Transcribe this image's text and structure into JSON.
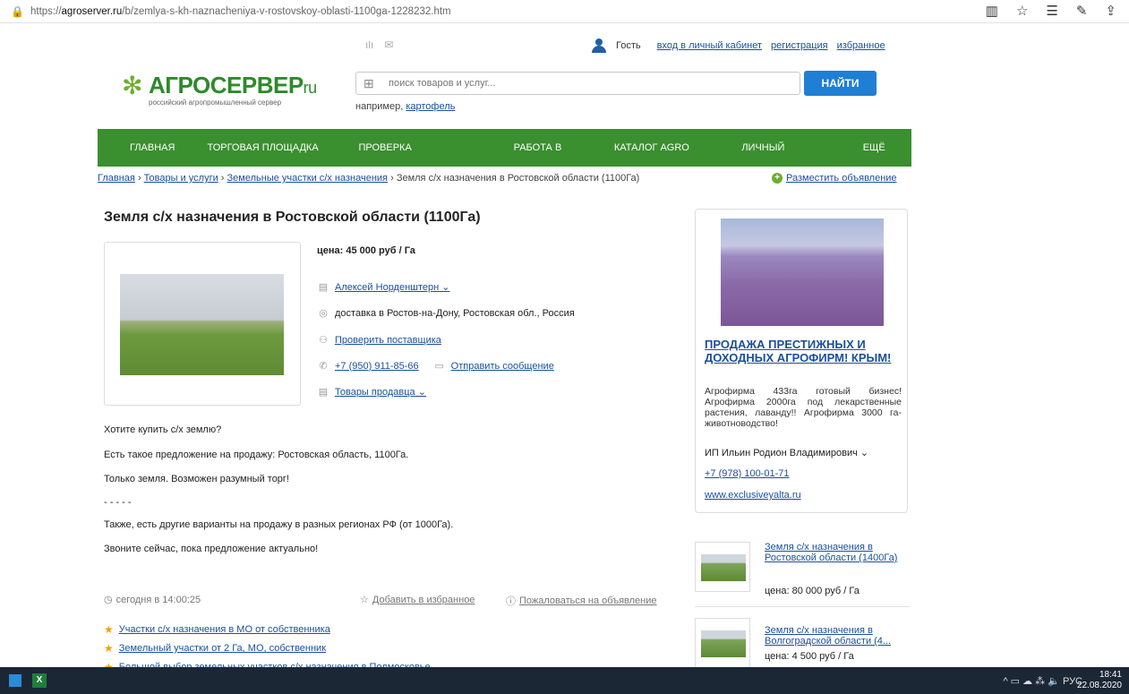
{
  "browser": {
    "url_prefix": "https://",
    "url_domain": "agroserver.ru",
    "url_path": "/b/zemlya-s-kh-naznacheniya-v-rostovskoy-oblasti-1100ga-1228232.htm",
    "tools": [
      "▥",
      "☆",
      "☰",
      "✎",
      "⇪"
    ]
  },
  "user": {
    "guest": "Гость",
    "login": "вход в личный кабинет",
    "register": "регистрация",
    "favorites": "избранное"
  },
  "logo": {
    "name": "АГРОСЕРВЕР",
    "suffix": "ru",
    "tagline": "российский агропромышленный сервер"
  },
  "search": {
    "placeholder": "поиск товаров и услуг...",
    "button": "НАЙТИ",
    "example_label": "например,",
    "example_link": "картофель"
  },
  "nav": [
    "ГЛАВНАЯ",
    "ТОРГОВАЯ ПЛОЩАДКА ⌄",
    "ПРОВЕРКА КОНТРАГЕНТА",
    "РАБОТА В АПК",
    "КАТАЛОГ AGRO TOP",
    "ЛИЧНЫЙ КАБИНЕТ",
    "ЕЩЁ ⌄"
  ],
  "breadcrumb": {
    "home": "Главная",
    "goods": "Товары и услуги",
    "category": "Земельные участки с/х назначения",
    "current": "Земля с/х назначения в Ростовской области (1100Га)",
    "sep": "›"
  },
  "post_ad": "Разместить объявление",
  "listing": {
    "title": "Земля с/х назначения в Ростовской области (1100Га)",
    "price": "цена: 45 000 руб / Га",
    "seller": "Алексей Норденштерн",
    "delivery": "доставка в Ростов-на-Дону, Ростовская обл., Россия",
    "check_supplier": "Проверить поставщика",
    "phone": "+7 (950) 911-85-66",
    "send_message": "Отправить сообщение",
    "seller_goods": "Товары продавца",
    "description": [
      "Хотите купить с/х землю?",
      "Есть такое предложение на продажу: Ростовская область, 1100Га.",
      "Только земля. Возможен разумный торг!",
      " - - - - -",
      "Также, есть другие варианты на продажу в разных регионах РФ (от 1000Га).",
      "Звоните сейчас, пока предложение актуально!"
    ],
    "date": "сегодня в 14:00:25",
    "add_favorite": "Добавить в избранное",
    "report": "Пожаловаться на объявление"
  },
  "related": [
    "Участки с/х назначения в МО от собственника",
    "Земельный участки от 2 Га, МО, собственник",
    "Большой выбор земельных участков с/х назначения в Подмосковье"
  ],
  "ad": {
    "title": "ПРОДАЖА ПРЕСТИЖНЫХ И ДОХОДНЫХ АГРОФИРМ! КРЫМ!",
    "text": "Агрофирма 433га готовый бизнес! Агрофирма 2000га под лекарственные растения, лаванду!! Агрофирма 3000 га- животноводство!",
    "seller": "ИП Ильин Родион Владимирович ⌄",
    "phone": "+7 (978) 100-01-71",
    "site": "www.exclusiveyalta.ru"
  },
  "similar": [
    {
      "title": "Земля с/х назначения в Ростовской области (1400Га)",
      "price": "цена: 80 000 руб / Га"
    },
    {
      "title": "Земля с/х назначения в Волгоградской области (4...",
      "price": "цена: 4 500 руб / Га"
    }
  ],
  "taskbar": {
    "excel": "X",
    "tray": "^  ▭  ☁  ⁂  🔈  РУС",
    "time": "18:41",
    "date": "22.08.2020"
  }
}
